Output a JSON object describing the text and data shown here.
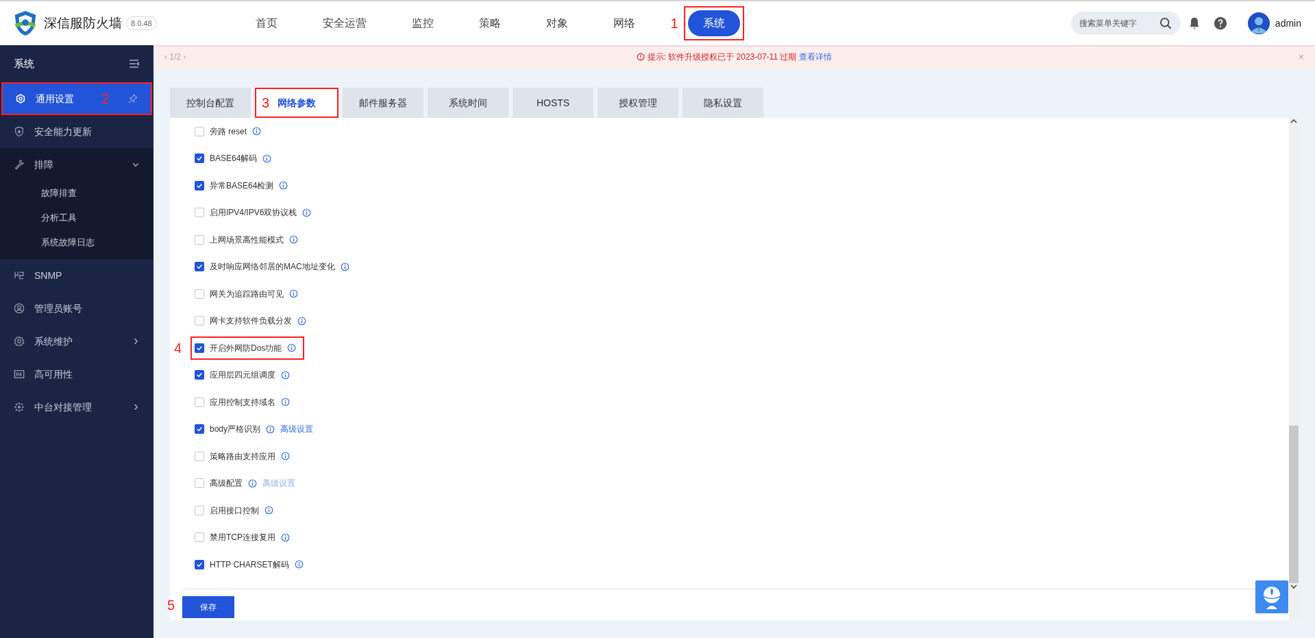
{
  "brand": {
    "title": "深信服防火墙",
    "version": "8.0.48"
  },
  "nav": [
    {
      "label": "首页",
      "selected": false
    },
    {
      "label": "安全运营",
      "selected": false
    },
    {
      "label": "监控",
      "selected": false
    },
    {
      "label": "策略",
      "selected": false
    },
    {
      "label": "对象",
      "selected": false
    },
    {
      "label": "网络",
      "selected": false
    },
    {
      "label": "系统",
      "selected": true,
      "annotation": "1"
    }
  ],
  "search": {
    "placeholder": "搜索菜单关键字"
  },
  "user": {
    "name": "admin"
  },
  "notice": {
    "pager": "‹ 1/2 ›",
    "prefix": "提示: 软件升级授权已于 2023-07-11 过期",
    "link": "查看详情",
    "close": "×"
  },
  "sidebar": {
    "title": "系统",
    "items": [
      {
        "label": "通用设置",
        "selected": true,
        "annotation": "2"
      },
      {
        "label": "安全能力更新",
        "selected": false
      },
      {
        "label": "排障",
        "selected": false,
        "expanded": true,
        "children": [
          {
            "label": "故障排查",
            "selected": false
          },
          {
            "label": "分析工具",
            "selected": false
          },
          {
            "label": "系统故障日志",
            "selected": false
          }
        ]
      },
      {
        "label": "SNMP",
        "selected": false
      },
      {
        "label": "管理员账号",
        "selected": false
      },
      {
        "label": "系统维护",
        "selected": false,
        "expanded": false
      },
      {
        "label": "高可用性",
        "selected": false
      },
      {
        "label": "中台对接管理",
        "selected": false,
        "expanded": false
      }
    ]
  },
  "tabs": [
    {
      "label": "控制台配置",
      "selected": false
    },
    {
      "label": "网络参数",
      "selected": true,
      "annotation": "3"
    },
    {
      "label": "邮件服务器",
      "selected": false
    },
    {
      "label": "系统时间",
      "selected": false
    },
    {
      "label": "HOSTS",
      "selected": false
    },
    {
      "label": "授权管理",
      "selected": false
    },
    {
      "label": "隐私设置",
      "selected": false
    }
  ],
  "options": [
    {
      "label": "旁路 reset",
      "checked": false
    },
    {
      "label": "BASE64解码",
      "checked": true
    },
    {
      "label": "异常BASE64检测",
      "checked": true
    },
    {
      "label": "启用IPV4/IPV6双协议栈",
      "checked": false
    },
    {
      "label": "上网场景高性能模式",
      "checked": false
    },
    {
      "label": "及时响应网络邻居的MAC地址变化",
      "checked": true
    },
    {
      "label": "网关为追踪路由可见",
      "checked": false
    },
    {
      "label": "网卡支持软件负载分发",
      "checked": false
    },
    {
      "label": "开启外网防Dos功能",
      "checked": true,
      "annotation": "4"
    },
    {
      "label": "应用层四元组调度",
      "checked": true
    },
    {
      "label": "应用控制支持域名",
      "checked": false
    },
    {
      "label": "body严格识别",
      "checked": true,
      "link": {
        "text": "高级设置",
        "disabled": false
      }
    },
    {
      "label": "策略路由支持应用",
      "checked": false
    },
    {
      "label": "高级配置",
      "checked": false,
      "link": {
        "text": "高级设置",
        "disabled": true
      }
    },
    {
      "label": "启用接口控制",
      "checked": false
    },
    {
      "label": "禁用TCP连接复用",
      "checked": false
    },
    {
      "label": "HTTP CHARSET解码",
      "checked": true
    }
  ],
  "save": {
    "label": "保存",
    "annotation": "5"
  }
}
